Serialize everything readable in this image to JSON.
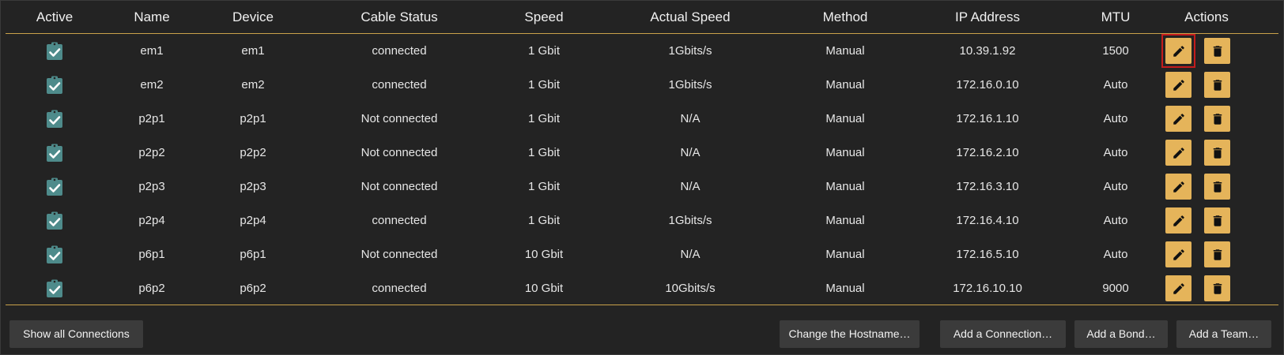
{
  "table": {
    "headers": {
      "active": "Active",
      "name": "Name",
      "device": "Device",
      "cable_status": "Cable Status",
      "speed": "Speed",
      "actual_speed": "Actual Speed",
      "method": "Method",
      "ip_address": "IP Address",
      "mtu": "MTU",
      "actions": "Actions"
    },
    "rows": [
      {
        "name": "em1",
        "device": "em1",
        "cable_status": "connected",
        "speed": "1 Gbit",
        "actual_speed": "1Gbits/s",
        "method": "Manual",
        "ip_address": "10.39.1.92",
        "mtu": "1500",
        "active": true
      },
      {
        "name": "em2",
        "device": "em2",
        "cable_status": "connected",
        "speed": "1 Gbit",
        "actual_speed": "1Gbits/s",
        "method": "Manual",
        "ip_address": "172.16.0.10",
        "mtu": "Auto",
        "active": true
      },
      {
        "name": "p2p1",
        "device": "p2p1",
        "cable_status": "Not connected",
        "speed": "1 Gbit",
        "actual_speed": "N/A",
        "method": "Manual",
        "ip_address": "172.16.1.10",
        "mtu": "Auto",
        "active": true
      },
      {
        "name": "p2p2",
        "device": "p2p2",
        "cable_status": "Not connected",
        "speed": "1 Gbit",
        "actual_speed": "N/A",
        "method": "Manual",
        "ip_address": "172.16.2.10",
        "mtu": "Auto",
        "active": true
      },
      {
        "name": "p2p3",
        "device": "p2p3",
        "cable_status": "Not connected",
        "speed": "1 Gbit",
        "actual_speed": "N/A",
        "method": "Manual",
        "ip_address": "172.16.3.10",
        "mtu": "Auto",
        "active": true
      },
      {
        "name": "p2p4",
        "device": "p2p4",
        "cable_status": "connected",
        "speed": "1 Gbit",
        "actual_speed": "1Gbits/s",
        "method": "Manual",
        "ip_address": "172.16.4.10",
        "mtu": "Auto",
        "active": true
      },
      {
        "name": "p6p1",
        "device": "p6p1",
        "cable_status": "Not connected",
        "speed": "10 Gbit",
        "actual_speed": "N/A",
        "method": "Manual",
        "ip_address": "172.16.5.10",
        "mtu": "Auto",
        "active": true
      },
      {
        "name": "p6p2",
        "device": "p6p2",
        "cable_status": "connected",
        "speed": "10 Gbit",
        "actual_speed": "10Gbits/s",
        "method": "Manual",
        "ip_address": "172.16.10.10",
        "mtu": "9000",
        "active": true
      }
    ],
    "highlighted_row": 0
  },
  "footer": {
    "show_all_label": "Show all Connections",
    "change_hostname_label": "Change the Hostname…",
    "add_connection_label": "Add a Connection…",
    "add_bond_label": "Add a Bond…",
    "add_team_label": "Add a Team…"
  },
  "icons": {
    "active": "clipboard-check-icon",
    "edit": "pencil-icon",
    "delete": "trash-icon"
  },
  "colors": {
    "background": "#232323",
    "accent": "#e5b45a",
    "active_icon": "#4e8b8b",
    "divider": "#c9a14a",
    "highlight": "#c41c1c",
    "button_bg": "#3b3b3b"
  }
}
